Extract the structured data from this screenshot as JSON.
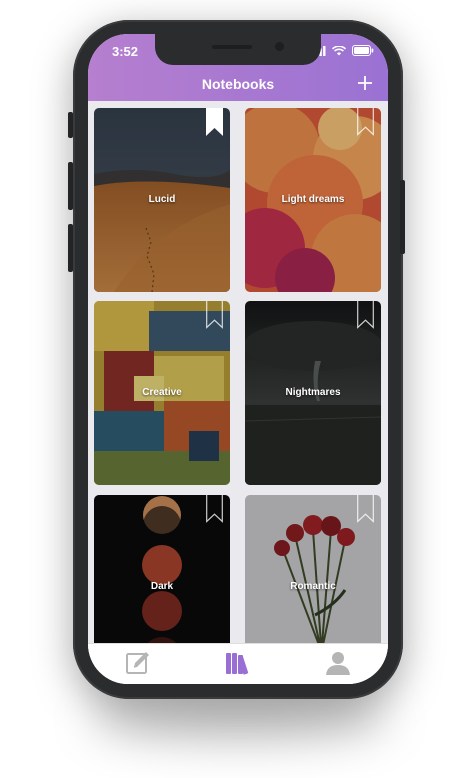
{
  "status_bar": {
    "time": "3:52",
    "icons": [
      "signal-icon",
      "wifi-icon",
      "battery-icon"
    ]
  },
  "header": {
    "title": "Notebooks",
    "add_icon": "plus-icon"
  },
  "notebooks": [
    {
      "name": "Lucid",
      "bookmarked": true
    },
    {
      "name": "Light dreams",
      "bookmarked": false
    },
    {
      "name": "Creative",
      "bookmarked": false
    },
    {
      "name": "Nightmares",
      "bookmarked": false
    },
    {
      "name": "Dark",
      "bookmarked": false
    },
    {
      "name": "Romantic",
      "bookmarked": false
    }
  ],
  "tab_bar": {
    "tabs": [
      {
        "icon": "edit-icon",
        "active": false
      },
      {
        "icon": "books-icon",
        "active": true
      },
      {
        "icon": "profile-icon",
        "active": false
      }
    ],
    "active_color": "#9a6fd4",
    "inactive_color": "#b5b5b5"
  },
  "colors": {
    "header_start": "#b67fcf",
    "header_end": "#9a72d3",
    "background": "#e9e9ee"
  }
}
